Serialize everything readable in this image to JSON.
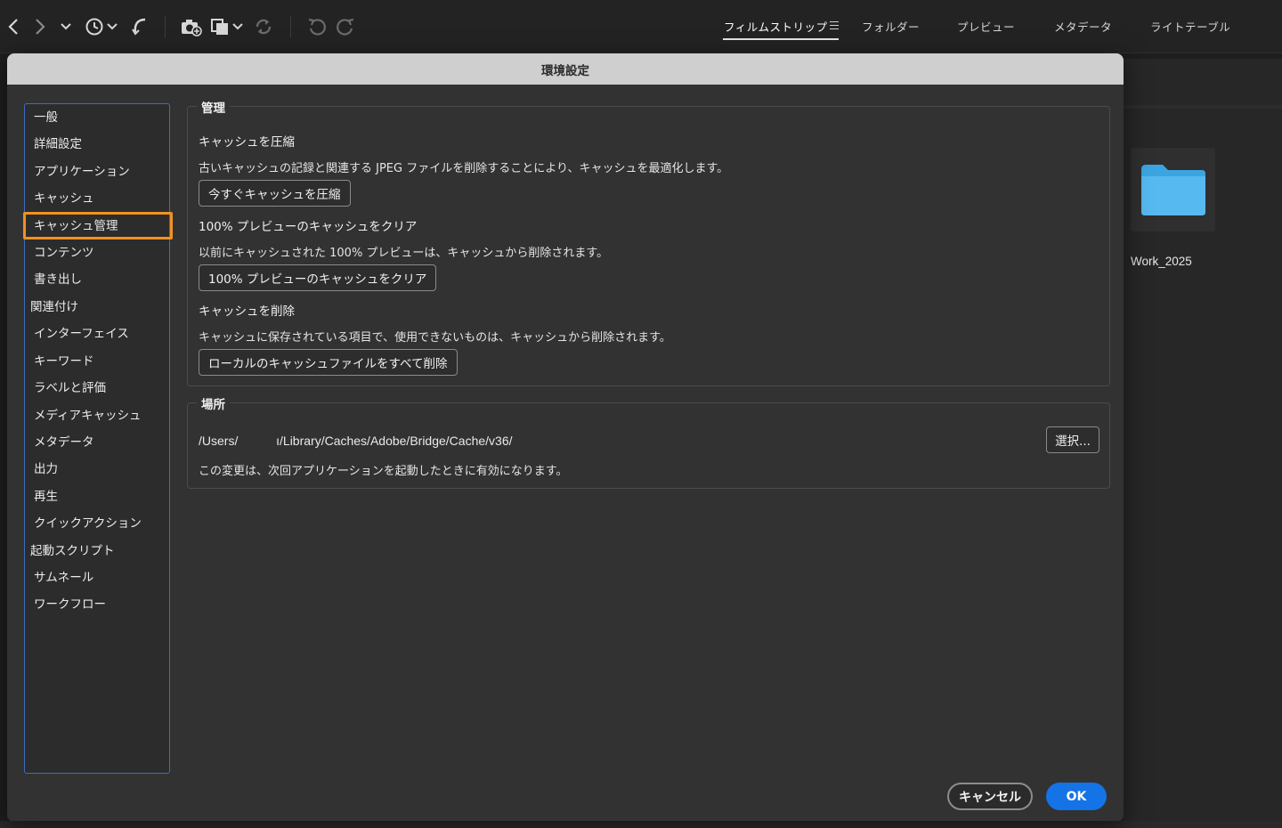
{
  "toolbar": {
    "icons": [
      "back-icon",
      "forward-icon",
      "chevron-down-icon",
      "recent-history-icon",
      "return-icon",
      "camera-import-icon",
      "copy-files-icon",
      "refresh-icon",
      "rotate-left-icon",
      "rotate-right-icon"
    ],
    "workspaces": [
      {
        "label": "フィルムストリップ",
        "active": true
      },
      {
        "label": "フォルダー",
        "active": false
      },
      {
        "label": "プレビュー",
        "active": false
      },
      {
        "label": "メタデータ",
        "active": false
      },
      {
        "label": "ライトテーブル",
        "active": false
      }
    ]
  },
  "content_browser": {
    "folder_name": "Work_2025",
    "folder_color": "#3fa9e8"
  },
  "dialog": {
    "title": "環境設定",
    "nav_items": [
      "一般",
      "詳細設定",
      "アプリケーション",
      "キャッシュ",
      "キャッシュ管理",
      "コンテンツ",
      "書き出し",
      "関連付け",
      "インターフェイス",
      "キーワード",
      "ラベルと評価",
      "メディアキャッシュ",
      "メタデータ",
      "出力",
      "再生",
      "クイックアクション",
      "起動スクリプト",
      "サムネール",
      "ワークフロー"
    ],
    "selected_nav": "キャッシュ管理",
    "management": {
      "title": "管理",
      "compact_heading": "キャッシュを圧縮",
      "compact_desc": "古いキャッシュの記録と関連する JPEG ファイルを削除することにより、キャッシュを最適化します。",
      "compact_button": "今すぐキャッシュを圧縮",
      "clear100_heading": "100% プレビューのキャッシュをクリア",
      "clear100_desc": "以前にキャッシュされた 100% プレビューは、キャッシュから削除されます。",
      "clear100_button": "100% プレビューのキャッシュをクリア",
      "purge_heading": "キャッシュを削除",
      "purge_desc": "キャッシュに保存されている項目で、使用できないものは、キャッシュから削除されます。",
      "purge_button": "ローカルのキャッシュファイルをすべて削除"
    },
    "location": {
      "title": "場所",
      "path": "/Users/           ı/Library/Caches/Adobe/Bridge/Cache/v36/",
      "choose_button": "選択...",
      "note": "この変更は、次回アプリケーションを起動したときに有効になります。"
    },
    "cancel_button": "キャンセル",
    "ok_button": "OK",
    "colors": {
      "highlight": "#f0921e",
      "primary": "#1473e6",
      "nav_border": "#3d6cc4"
    }
  }
}
